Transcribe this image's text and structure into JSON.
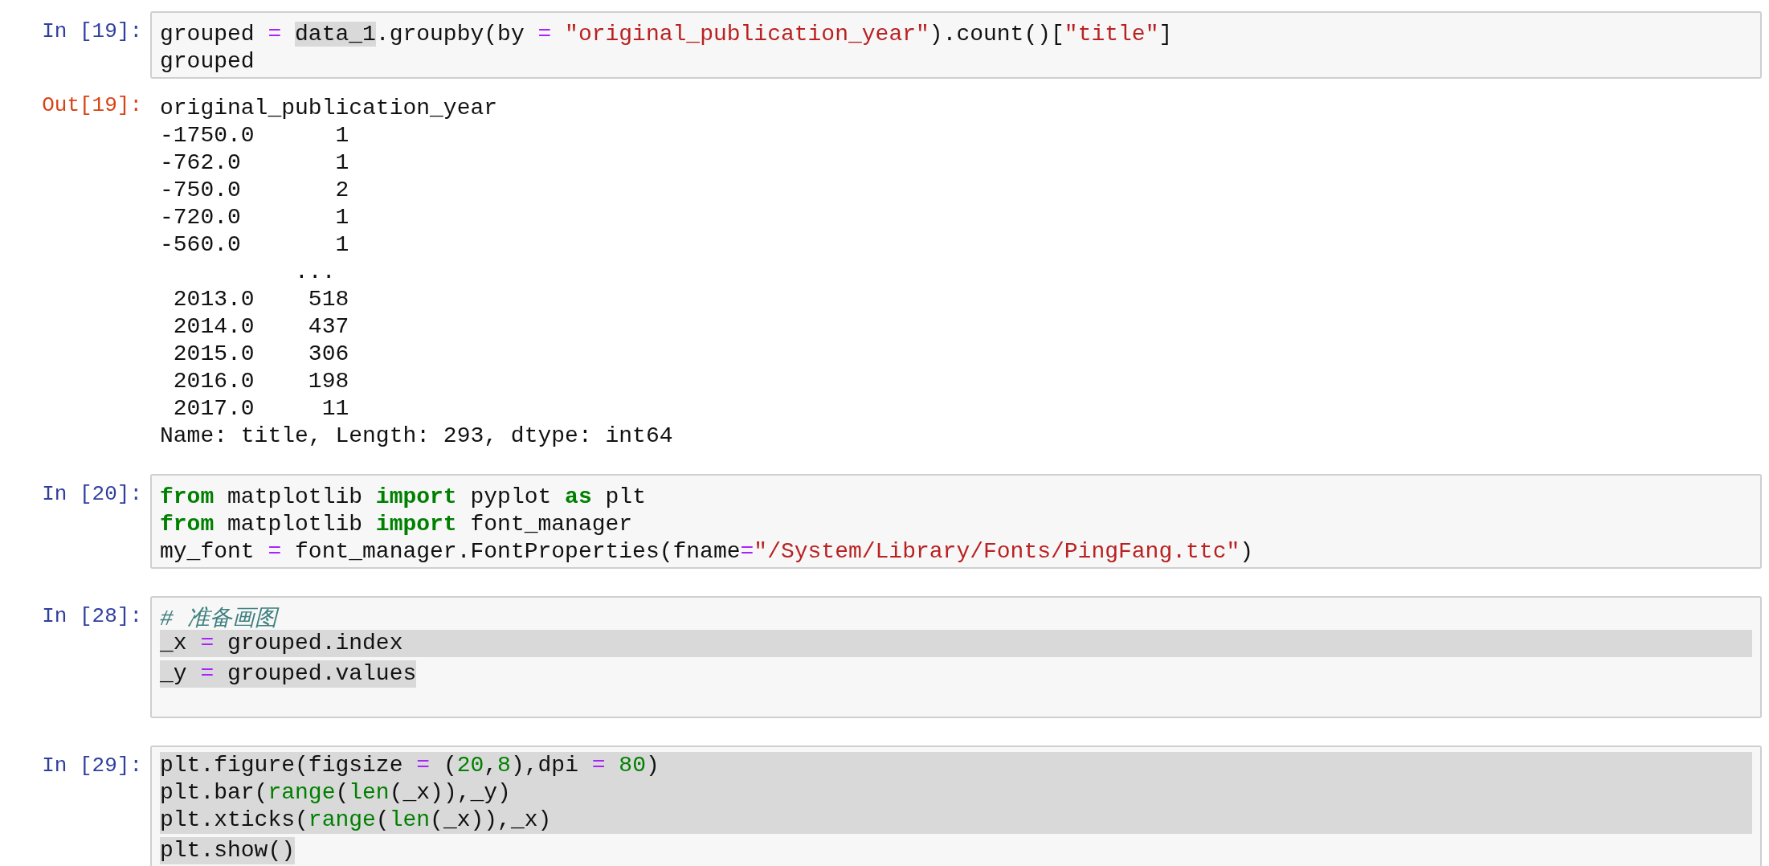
{
  "cells": [
    {
      "kind": "code",
      "prompt": "In [19]:",
      "lines": [
        {
          "kind": "plain",
          "tokens": [
            {
              "text": "grouped ",
              "kind": "plain"
            },
            {
              "text": "= ",
              "kind": "operator"
            },
            {
              "text": "data_1",
              "kind": "match"
            },
            {
              "text": ".groupby(by ",
              "kind": "plain"
            },
            {
              "text": "= ",
              "kind": "operator"
            },
            {
              "text": "\"original_publication_year\"",
              "kind": "string"
            },
            {
              "text": ").count()[",
              "kind": "plain"
            },
            {
              "text": "\"title\"",
              "kind": "string"
            },
            {
              "text": "]",
              "kind": "plain"
            }
          ]
        },
        {
          "kind": "plain",
          "tokens": [
            {
              "text": "grouped",
              "kind": "plain"
            }
          ]
        }
      ],
      "output": {
        "prompt": "Out[19]:",
        "lines": [
          "original_publication_year",
          "-1750.0      1",
          "-762.0       1",
          "-750.0       2",
          "-720.0       1",
          "-560.0       1",
          "          ...",
          " 2013.0    518",
          " 2014.0    437",
          " 2015.0    306",
          " 2016.0    198",
          " 2017.0     11",
          "Name: title, Length: 293, dtype: int64"
        ]
      }
    },
    {
      "kind": "code",
      "prompt": "In [20]:",
      "lines": [
        {
          "kind": "plain",
          "tokens": [
            {
              "text": "from",
              "kind": "keyword"
            },
            {
              "text": " matplotlib ",
              "kind": "plain"
            },
            {
              "text": "import",
              "kind": "keyword"
            },
            {
              "text": " pyplot ",
              "kind": "plain"
            },
            {
              "text": "as",
              "kind": "keyword"
            },
            {
              "text": " plt",
              "kind": "plain"
            }
          ]
        },
        {
          "kind": "plain",
          "tokens": [
            {
              "text": "from",
              "kind": "keyword"
            },
            {
              "text": " matplotlib ",
              "kind": "plain"
            },
            {
              "text": "import",
              "kind": "keyword"
            },
            {
              "text": " font_manager",
              "kind": "plain"
            }
          ]
        },
        {
          "kind": "plain",
          "tokens": [
            {
              "text": "my_font ",
              "kind": "plain"
            },
            {
              "text": "=",
              "kind": "operator"
            },
            {
              "text": " font_manager.FontProperties(fname",
              "kind": "plain"
            },
            {
              "text": "=",
              "kind": "operator"
            },
            {
              "text": "\"/System/Library/Fonts/PingFang.ttc\"",
              "kind": "string"
            },
            {
              "text": ")",
              "kind": "plain"
            }
          ]
        }
      ]
    },
    {
      "kind": "code",
      "prompt": "In [28]:",
      "lines": [
        {
          "kind": "plain",
          "tokens": [
            {
              "text": "# 准备画图",
              "kind": "comment"
            }
          ]
        },
        {
          "kind": "highlighted_full",
          "tokens": [
            {
              "text": "_x ",
              "kind": "plain"
            },
            {
              "text": "=",
              "kind": "operator"
            },
            {
              "text": " grouped.index",
              "kind": "plain"
            }
          ]
        },
        {
          "kind": "highlighted",
          "tokens": [
            {
              "text": "_y ",
              "kind": "plain"
            },
            {
              "text": "=",
              "kind": "operator"
            },
            {
              "text": " grouped.values",
              "kind": "plain"
            }
          ]
        },
        {
          "kind": "blank"
        }
      ]
    },
    {
      "kind": "code",
      "prompt": "In [29]:",
      "lines": [
        {
          "kind": "highlighted_full",
          "tokens": [
            {
              "text": "plt.figure(figsize ",
              "kind": "plain"
            },
            {
              "text": "=",
              "kind": "operator"
            },
            {
              "text": " (",
              "kind": "plain"
            },
            {
              "text": "20",
              "kind": "number"
            },
            {
              "text": ",",
              "kind": "plain"
            },
            {
              "text": "8",
              "kind": "number"
            },
            {
              "text": "),dpi ",
              "kind": "plain"
            },
            {
              "text": "= ",
              "kind": "operator"
            },
            {
              "text": "80",
              "kind": "number"
            },
            {
              "text": ")",
              "kind": "plain"
            }
          ]
        },
        {
          "kind": "highlighted_full",
          "tokens": [
            {
              "text": "plt.bar(",
              "kind": "plain"
            },
            {
              "text": "range",
              "kind": "builtin"
            },
            {
              "text": "(",
              "kind": "plain"
            },
            {
              "text": "len",
              "kind": "builtin"
            },
            {
              "text": "(_x)),_y)",
              "kind": "plain"
            }
          ]
        },
        {
          "kind": "highlighted_full",
          "tokens": [
            {
              "text": "plt.xticks(",
              "kind": "plain"
            },
            {
              "text": "range",
              "kind": "builtin"
            },
            {
              "text": "(",
              "kind": "plain"
            },
            {
              "text": "len",
              "kind": "builtin"
            },
            {
              "text": "(_x)),_x)",
              "kind": "plain"
            }
          ]
        },
        {
          "kind": "highlighted",
          "tokens": [
            {
              "text": "plt.show()",
              "kind": "plain"
            }
          ]
        }
      ]
    }
  ]
}
